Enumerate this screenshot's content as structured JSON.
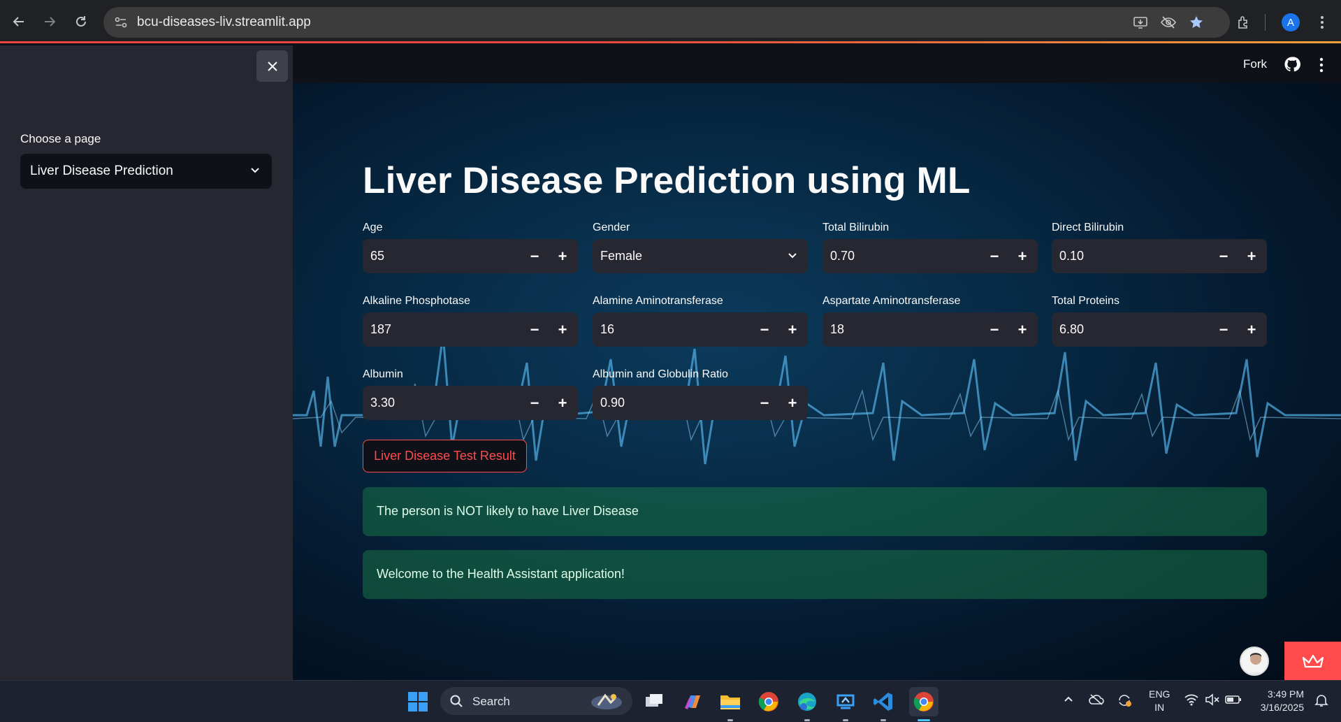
{
  "browser": {
    "url": "bcu-diseases-liv.streamlit.app",
    "profile_initial": "A"
  },
  "sidebar": {
    "select_label": "Choose a page",
    "select_value": "Liver Disease Prediction"
  },
  "header": {
    "fork_label": "Fork"
  },
  "main": {
    "title": "Liver Disease Prediction using ML",
    "fields": {
      "age": {
        "label": "Age",
        "value": "65"
      },
      "gender": {
        "label": "Gender",
        "value": "Female"
      },
      "total_bilirubin": {
        "label": "Total Bilirubin",
        "value": "0.70"
      },
      "direct_bilirubin": {
        "label": "Direct Bilirubin",
        "value": "0.10"
      },
      "alkaline_phosphotase": {
        "label": "Alkaline Phosphotase",
        "value": "187"
      },
      "alamine_aminotransferase": {
        "label": "Alamine Aminotransferase",
        "value": "16"
      },
      "aspartate_aminotransferase": {
        "label": "Aspartate Aminotransferase",
        "value": "18"
      },
      "total_proteins": {
        "label": "Total Proteins",
        "value": "6.80"
      },
      "albumin": {
        "label": "Albumin",
        "value": "3.30"
      },
      "ag_ratio": {
        "label": "Albumin and Globulin Ratio",
        "value": "0.90"
      }
    },
    "stepper_minus": "−",
    "stepper_plus": "+",
    "result_button": "Liver Disease Test Result",
    "result_message": "The person is NOT likely to have Liver Disease",
    "welcome_message": "Welcome to the Health Assistant application!"
  },
  "taskbar": {
    "search_placeholder": "Search",
    "lang_line1": "ENG",
    "lang_line2": "IN",
    "time": "3:49 PM",
    "date": "3/16/2025"
  },
  "colors": {
    "accent": "#ff4b4b",
    "success_bg": "#177245",
    "sidebar_bg": "#262730",
    "app_bg": "#0e1117"
  }
}
